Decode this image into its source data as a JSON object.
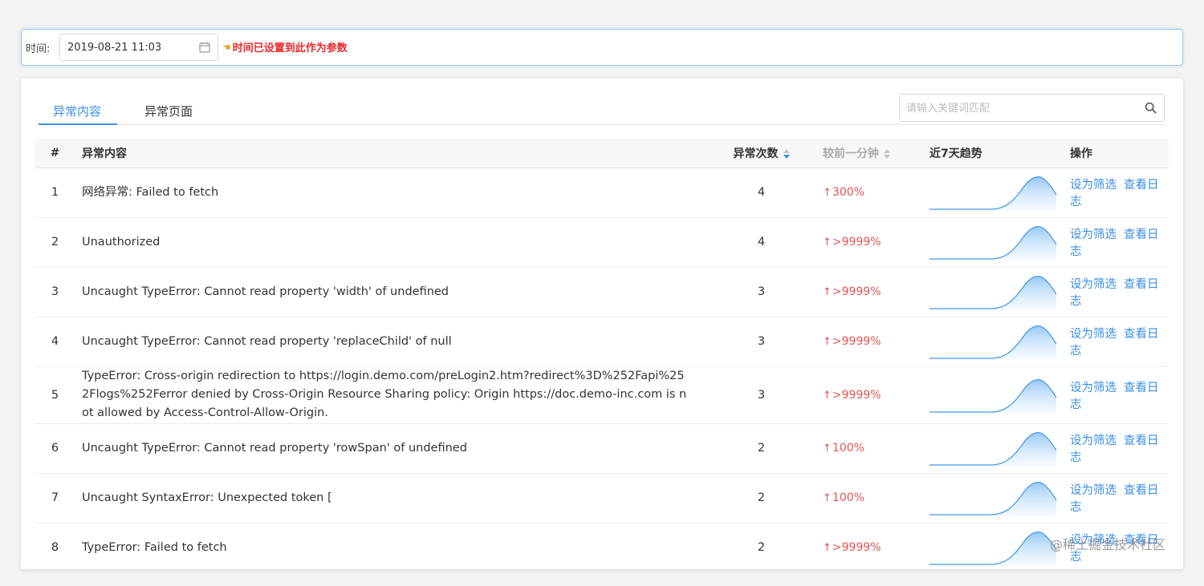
{
  "filter": {
    "time_label": "时间:",
    "date_value": "2019-08-21 11:03",
    "hint_text": "时间已设置到此作为参数"
  },
  "tabs": [
    {
      "label": "异常内容",
      "active": true
    },
    {
      "label": "异常页面",
      "active": false
    }
  ],
  "search": {
    "placeholder": "请输入关键词匹配"
  },
  "table": {
    "headers": {
      "index": "#",
      "content": "异常内容",
      "count": "异常次数",
      "change": "较前一分钟",
      "trend": "近7天趋势",
      "ops": "操作"
    },
    "rows": [
      {
        "index": "1",
        "content": "网络异常: Failed to fetch",
        "count": "4",
        "change": "300%"
      },
      {
        "index": "2",
        "content": "Unauthorized",
        "count": "4",
        "change": ">9999%"
      },
      {
        "index": "3",
        "content": "Uncaught TypeError: Cannot read property 'width' of undefined",
        "count": "3",
        "change": ">9999%"
      },
      {
        "index": "4",
        "content": "Uncaught TypeError: Cannot read property 'replaceChild' of null",
        "count": "3",
        "change": ">9999%"
      },
      {
        "index": "5",
        "content": "TypeError: Cross-origin redirection to https://login.demo.com/preLogin2.htm?redirect%3D%252Fapi%252Flogs%252Ferror denied by Cross-Origin Resource Sharing policy: Origin https://doc.demo-inc.com is not allowed by Access-Control-Allow-Origin.",
        "count": "3",
        "change": ">9999%"
      },
      {
        "index": "6",
        "content": "Uncaught TypeError: Cannot read property 'rowSpan' of undefined",
        "count": "2",
        "change": "100%"
      },
      {
        "index": "7",
        "content": "Uncaught SyntaxError: Unexpected token [",
        "count": "2",
        "change": "100%"
      },
      {
        "index": "8",
        "content": "TypeError: Failed to fetch",
        "count": "2",
        "change": ">9999%"
      }
    ],
    "op_filter_label": "设为筛选",
    "op_log_label": "查看日志"
  },
  "icons": {
    "calendar": "calendar-icon",
    "search": "search-icon",
    "hint": "pointing-hand-icon",
    "up_arrow": "arrow-up-icon"
  },
  "colors": {
    "accent": "#3a8ee6",
    "danger": "#e45454",
    "hint": "#e9292c"
  },
  "watermark": "@稀土掘金技术社区"
}
